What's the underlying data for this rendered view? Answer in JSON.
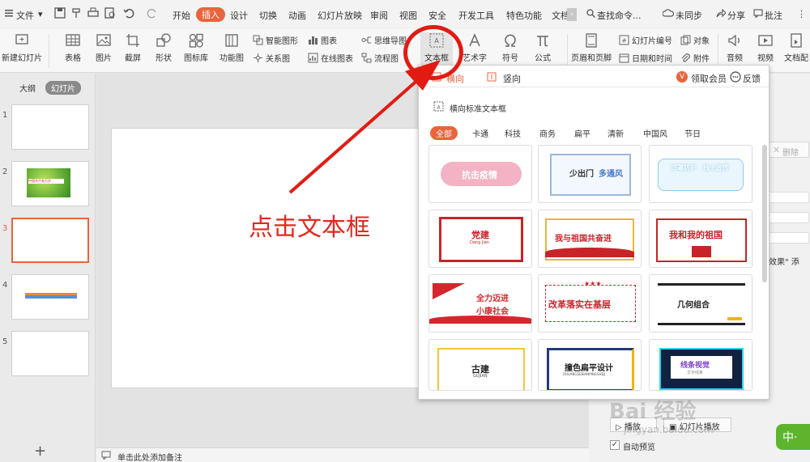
{
  "menubar": {
    "file_label": "文件",
    "tabs": [
      "开始",
      "插入",
      "设计",
      "切换",
      "动画",
      "幻灯片放映",
      "审阅",
      "视图",
      "安全",
      "开发工具",
      "特色功能",
      "文档"
    ],
    "search": "查找命令...",
    "sync": "未同步",
    "share": "分享",
    "comment": "批注"
  },
  "ribbon": {
    "new_slide": "新建幻灯片",
    "table": "表格",
    "image": "图片",
    "screenshot": "截屏",
    "shape": "形状",
    "icon_lib": "图标库",
    "func_chart": "功能图",
    "smart_shape": "智能图形",
    "chart": "图表",
    "mind_map": "思维导图",
    "relation": "关系图",
    "online_chart": "在线图表",
    "flowchart": "流程图",
    "textbox": "文本框",
    "art_text": "艺术字",
    "symbol": "符号",
    "formula": "公式",
    "header_footer": "页眉和页脚",
    "slide_number": "幻灯片编号",
    "object": "对象",
    "datetime": "日期和时间",
    "attachment": "附件",
    "audio": "音频",
    "video": "视频",
    "doc_match": "文档配"
  },
  "left_panel": {
    "outline_tab": "大纲",
    "slides_tab": "幻灯片",
    "numbers": [
      "1",
      "2",
      "3",
      "4",
      "5"
    ],
    "thumb2_text": "中国共产党万岁",
    "add": "+"
  },
  "slide": {
    "annotation": "点击文本框"
  },
  "notes": {
    "placeholder": "单击此处添加备注"
  },
  "dropdown": {
    "tab_horizontal": "横向",
    "tab_vertical": "竖向",
    "vip": "领取会员",
    "feedback": "反馈",
    "standard": "横向标准文本框",
    "categories": [
      "全部",
      "卡通",
      "科技",
      "商务",
      "扁平",
      "清新",
      "中国风",
      "节日"
    ],
    "cards": [
      {
        "title": "抗击疫情"
      },
      {
        "title": "少出门",
        "sub": "多通风"
      },
      {
        "title": "口罩防护",
        "sub": "线上宣传"
      },
      {
        "title": "党建",
        "sub": "Dang Jian"
      },
      {
        "title": "我与祖国共奋进"
      },
      {
        "title": "我和我的祖国"
      },
      {
        "title": "全力迈进",
        "sub": "小康社会"
      },
      {
        "title": "改革落实在基层"
      },
      {
        "title": "几何组合"
      },
      {
        "title": "古建",
        "sub": "GUJIAN"
      },
      {
        "title": "撞色扁平设计",
        "sub": "ZHUANGSEBIANPINGSHEJI"
      },
      {
        "title": "线条视觉",
        "sub": "文字线条"
      }
    ]
  },
  "right_panel": {
    "delete": "删除",
    "effect_text": "效果\" 添",
    "play": "播放",
    "slideshow": "幻灯片播放",
    "auto_preview": "自动预览"
  },
  "watermark": {
    "brand": "Bai 经验",
    "url": "jingyan.baidu.com"
  },
  "ime": "中·",
  "colors": {
    "accent": "#e8643c",
    "annotation_red": "#e21b12",
    "ime_green": "#5eb52d"
  }
}
